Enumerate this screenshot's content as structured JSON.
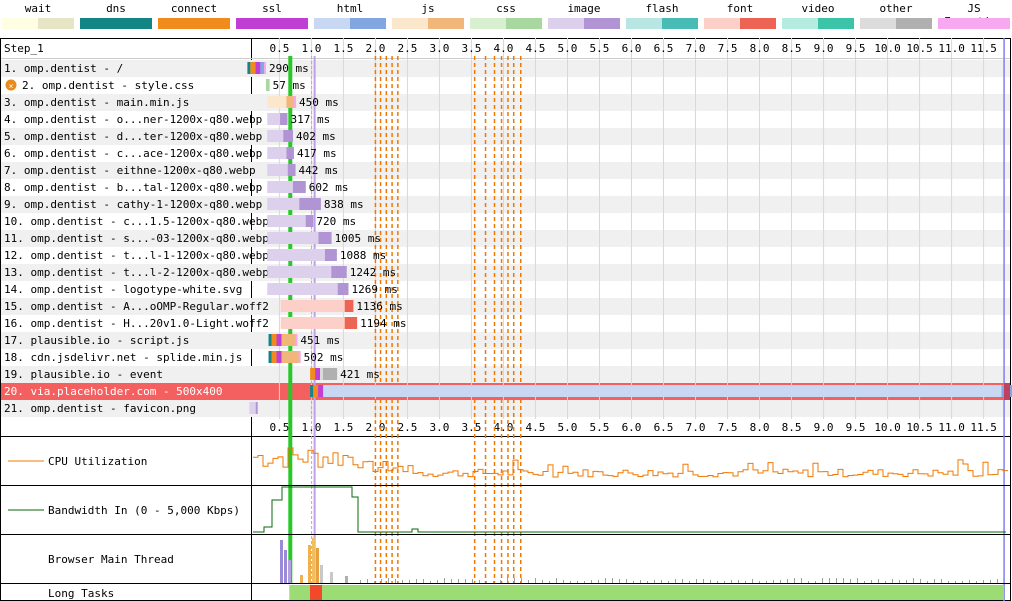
{
  "legend": [
    {
      "label": "wait",
      "colors": [
        "#fefee2",
        "#e6e6c6"
      ]
    },
    {
      "label": "dns",
      "colors": [
        "#138585",
        "#138585"
      ]
    },
    {
      "label": "connect",
      "colors": [
        "#f28b1e",
        "#f28b1e"
      ]
    },
    {
      "label": "ssl",
      "colors": [
        "#c13ed4",
        "#c13ed4"
      ]
    },
    {
      "label": "html",
      "colors": [
        "#c8d8f2",
        "#82a6e2"
      ]
    },
    {
      "label": "js",
      "colors": [
        "#fbe8cc",
        "#f0b67a"
      ]
    },
    {
      "label": "css",
      "colors": [
        "#d8f0d0",
        "#a8d8a0"
      ]
    },
    {
      "label": "image",
      "colors": [
        "#ddd0ec",
        "#b094d4"
      ]
    },
    {
      "label": "flash",
      "colors": [
        "#b8e6e2",
        "#48bcb4"
      ]
    },
    {
      "label": "font",
      "colors": [
        "#fcd0c8",
        "#ee6454"
      ]
    },
    {
      "label": "video",
      "colors": [
        "#b4ece0",
        "#3cc4a8"
      ]
    },
    {
      "label": "other",
      "colors": [
        "#dcdcdc",
        "#b0b0b0"
      ]
    },
    {
      "label": "JS Execution",
      "colors": [
        "#f6a8f0",
        "#f6a8f0"
      ]
    }
  ],
  "step_label": "Step_1",
  "chart_data": {
    "type": "waterfall",
    "x_unit": "s",
    "xlim": [
      0.0,
      11.9
    ],
    "ticks": [
      "0.5",
      "1.0",
      "1.5",
      "2.0",
      "2.5",
      "3.0",
      "3.5",
      "4.0",
      "4.5",
      "5.0",
      "5.5",
      "6.0",
      "6.5",
      "7.0",
      "7.5",
      "8.0",
      "8.5",
      "9.0",
      "9.5",
      "10.0",
      "10.5",
      "11.0",
      "11.5"
    ],
    "requests": [
      {
        "label": "1. omp.dentist - /",
        "start": 0.0,
        "wait": 0.05,
        "dur": 0.29,
        "type": "html",
        "dns": true,
        "connect": true,
        "ssl": true,
        "time_label": "290 ms"
      },
      {
        "label": "2. omp.dentist - style.css",
        "start": 0.29,
        "wait": 0.0,
        "dur": 0.057,
        "type": "css",
        "error": true,
        "time_label": "57 ms"
      },
      {
        "label": "3. omp.dentist - main.min.js",
        "start": 0.31,
        "wait": 0.3,
        "dur": 0.45,
        "type": "js",
        "time_label": "450 ms"
      },
      {
        "label": "4. omp.dentist - o...ner-1200x-q80.webp",
        "start": 0.31,
        "wait": 0.2,
        "dur": 0.317,
        "type": "image",
        "time_label": "317 ms"
      },
      {
        "label": "5. omp.dentist - d...ter-1200x-q80.webp",
        "start": 0.31,
        "wait": 0.25,
        "dur": 0.402,
        "type": "image",
        "time_label": "402 ms"
      },
      {
        "label": "6. omp.dentist - c...ace-1200x-q80.webp",
        "start": 0.31,
        "wait": 0.3,
        "dur": 0.417,
        "type": "image",
        "time_label": "417 ms"
      },
      {
        "label": "7. omp.dentist - eithne-1200x-q80.webp",
        "start": 0.31,
        "wait": 0.32,
        "dur": 0.442,
        "type": "image",
        "time_label": "442 ms"
      },
      {
        "label": "8. omp.dentist - b...tal-1200x-q80.webp",
        "start": 0.31,
        "wait": 0.4,
        "dur": 0.602,
        "type": "image",
        "time_label": "602 ms"
      },
      {
        "label": "9. omp.dentist - cathy-1-1200x-q80.webp",
        "start": 0.31,
        "wait": 0.5,
        "dur": 0.838,
        "type": "image",
        "time_label": "838 ms"
      },
      {
        "label": "10. omp.dentist - c...1.5-1200x-q80.webp",
        "start": 0.31,
        "wait": 0.6,
        "dur": 0.72,
        "type": "image",
        "time_label": "720 ms"
      },
      {
        "label": "11. omp.dentist - s...-03-1200x-q80.webp",
        "start": 0.31,
        "wait": 0.8,
        "dur": 1.005,
        "type": "image",
        "time_label": "1005 ms"
      },
      {
        "label": "12. omp.dentist - t...l-1-1200x-q80.webp",
        "start": 0.31,
        "wait": 0.9,
        "dur": 1.088,
        "type": "image",
        "time_label": "1088 ms"
      },
      {
        "label": "13. omp.dentist - t...l-2-1200x-q80.webp",
        "start": 0.31,
        "wait": 1.0,
        "dur": 1.242,
        "type": "image",
        "time_label": "1242 ms"
      },
      {
        "label": "14. omp.dentist - logotype-white.svg",
        "start": 0.31,
        "wait": 1.1,
        "dur": 1.269,
        "type": "image",
        "time_label": "1269 ms"
      },
      {
        "label": "15. omp.dentist - A...oOMP-Regular.woff2",
        "start": 0.52,
        "wait": 1.0,
        "dur": 1.136,
        "type": "font",
        "time_label": "1136 ms"
      },
      {
        "label": "16. omp.dentist - H...20v1.0-Light.woff2",
        "start": 0.52,
        "wait": 1.0,
        "dur": 1.194,
        "type": "font",
        "time_label": "1194 ms"
      },
      {
        "label": "17. plausible.io - script.js",
        "start": 0.33,
        "wait": 0.1,
        "dur": 0.451,
        "type": "js",
        "dns": true,
        "connect": true,
        "ssl": true,
        "time_label": "451 ms"
      },
      {
        "label": "18. cdn.jsdelivr.net - splide.min.js",
        "start": 0.33,
        "wait": 0.1,
        "dur": 0.502,
        "type": "js",
        "dns": true,
        "connect": true,
        "ssl": true,
        "time_label": "502 ms"
      },
      {
        "label": "19. plausible.io - event",
        "start": 0.98,
        "wait": 0.2,
        "dur": 0.421,
        "type": "other",
        "connect": true,
        "ssl": true,
        "time_label": "421 ms"
      },
      {
        "label": "20. via.placeholder.com - 500x400",
        "start": 0.98,
        "wait": 10.8,
        "dur": 11.0,
        "type": "html",
        "dns": true,
        "connect": true,
        "ssl": true,
        "highlight": true,
        "time_label": ""
      },
      {
        "label": "21. omp.dentist - favicon.png",
        "start": 0.03,
        "wait": 0.1,
        "dur": 0.12,
        "type": "image",
        "time_label": ""
      }
    ],
    "markers": {
      "start_render": 0.67,
      "dom_content_loaded": 1.05,
      "on_load": 11.82,
      "layout_shifts": [
        2.0,
        2.08,
        2.17,
        2.26,
        2.35,
        3.55,
        3.72,
        3.86,
        3.97,
        4.07,
        4.16,
        4.27
      ]
    },
    "cpu_label": "CPU Utilization",
    "bandwidth_label": "Bandwidth In (0 - 5,000 Kbps)",
    "main_thread_label": "Browser Main Thread",
    "long_tasks_label": "Long Tasks"
  }
}
